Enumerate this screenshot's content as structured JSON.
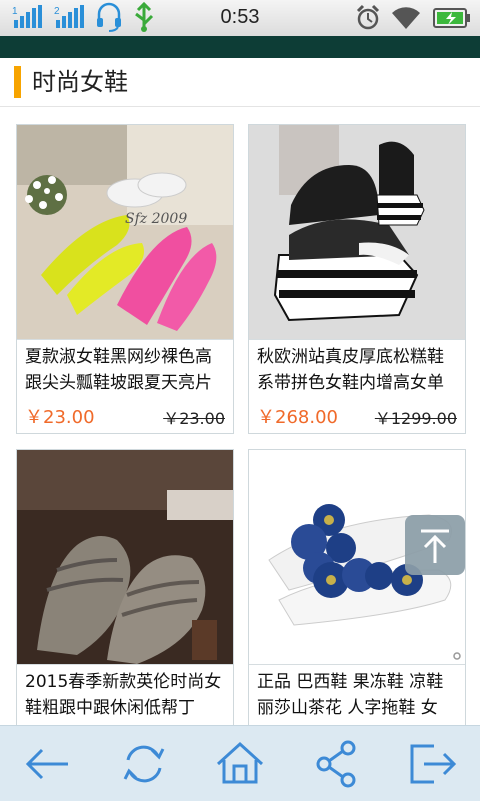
{
  "status_bar": {
    "time": "0:53",
    "icons": [
      "signal-1-icon",
      "signal-2-icon",
      "headset-icon",
      "usb-icon",
      "alarm-icon",
      "wifi-icon",
      "battery-charging-icon"
    ]
  },
  "header": {
    "title": "时尚女鞋",
    "accent_color": "#f7a400"
  },
  "products": [
    {
      "name": "夏款淑女鞋黑网纱裸色高跟尖头瓢鞋坡跟夏天亮片",
      "price": "￥23.00",
      "original_price": "￥23.00"
    },
    {
      "name": "秋欧洲站真皮厚底松糕鞋系带拼色女鞋内增高女单",
      "price": "￥268.00",
      "original_price": "￥1299.00"
    },
    {
      "name": "2015春季新款英伦时尚女鞋粗跟中跟休闲低帮丁",
      "price": "",
      "original_price": ""
    },
    {
      "name": "正品 巴西鞋 果冻鞋 凉鞋 丽莎山茶花 人字拖鞋 女",
      "price": "",
      "original_price": ""
    }
  ],
  "colors": {
    "price": "#f06a2a",
    "nav_bg": "#dce9f2",
    "nav_icon": "#3d8ad6",
    "band": "#0d3d36"
  },
  "bottom_nav": [
    "back-icon",
    "refresh-icon",
    "home-icon",
    "share-icon",
    "exit-icon"
  ]
}
